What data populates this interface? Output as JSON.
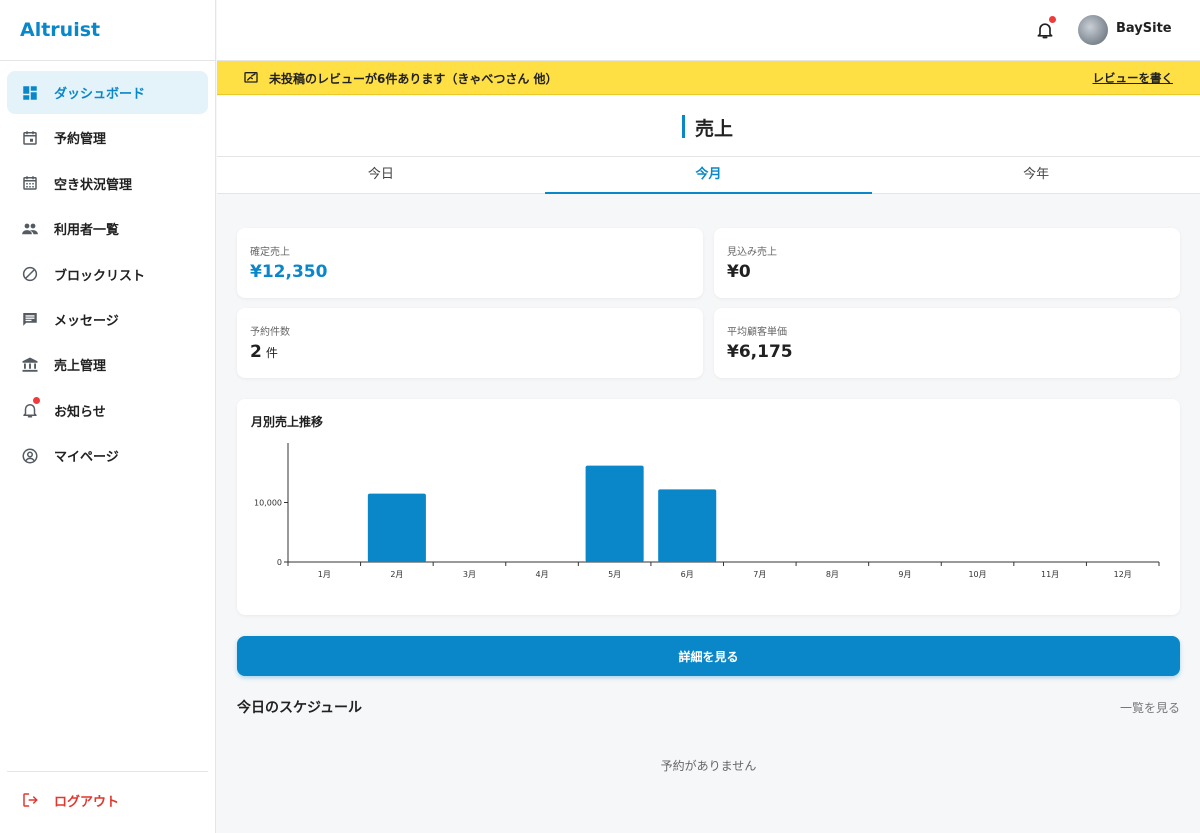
{
  "brand": {
    "name": "Altruist"
  },
  "sidebar": {
    "items": [
      {
        "label": "ダッシュボード",
        "icon": "dashboard-icon",
        "active": true
      },
      {
        "label": "予約管理",
        "icon": "calendar-icon"
      },
      {
        "label": "空き状況管理",
        "icon": "calendar-grid-icon"
      },
      {
        "label": "利用者一覧",
        "icon": "people-icon"
      },
      {
        "label": "ブロックリスト",
        "icon": "block-icon"
      },
      {
        "label": "メッセージ",
        "icon": "message-icon"
      },
      {
        "label": "売上管理",
        "icon": "bank-icon"
      },
      {
        "label": "お知らせ",
        "icon": "bell-icon",
        "has_notification": true
      },
      {
        "label": "マイページ",
        "icon": "account-circle-icon"
      }
    ],
    "logout_label": "ログアウト"
  },
  "header": {
    "username": "BaySite",
    "has_notification": true
  },
  "banner": {
    "text": "未投稿のレビューが6件あります（きゃべつさん 他）",
    "link_label": "レビューを書く"
  },
  "page": {
    "title": "売上"
  },
  "tabs": [
    {
      "label": "今日"
    },
    {
      "label": "今月",
      "active": true
    },
    {
      "label": "今年"
    }
  ],
  "stats": {
    "confirmed": {
      "label": "確定売上",
      "value": "¥12,350"
    },
    "expected": {
      "label": "見込み売上",
      "value": "¥0"
    },
    "bookings": {
      "label": "予約件数",
      "value": "2",
      "unit": "件"
    },
    "average": {
      "label": "平均顧客単価",
      "value": "¥6,175"
    }
  },
  "chart_data": {
    "type": "bar",
    "title": "月別売上推移",
    "categories": [
      "1月",
      "2月",
      "3月",
      "4月",
      "5月",
      "6月",
      "7月",
      "8月",
      "9月",
      "10月",
      "11月",
      "12月"
    ],
    "values": [
      0,
      11500,
      0,
      0,
      16200,
      12200,
      0,
      0,
      0,
      0,
      0,
      0
    ],
    "yticks": [
      0,
      10000
    ],
    "ytick_labels": [
      "0",
      "10,000"
    ],
    "ylim": [
      0,
      20000
    ],
    "color": "#0a87c9"
  },
  "actions": {
    "detail_label": "詳細を見る"
  },
  "schedule": {
    "title": "今日のスケジュール",
    "link_label": "一覧を見る",
    "empty_text": "予約がありません"
  },
  "colors": {
    "accent": "#0a87c9",
    "banner": "#fedf44",
    "danger": "#e0382e"
  }
}
